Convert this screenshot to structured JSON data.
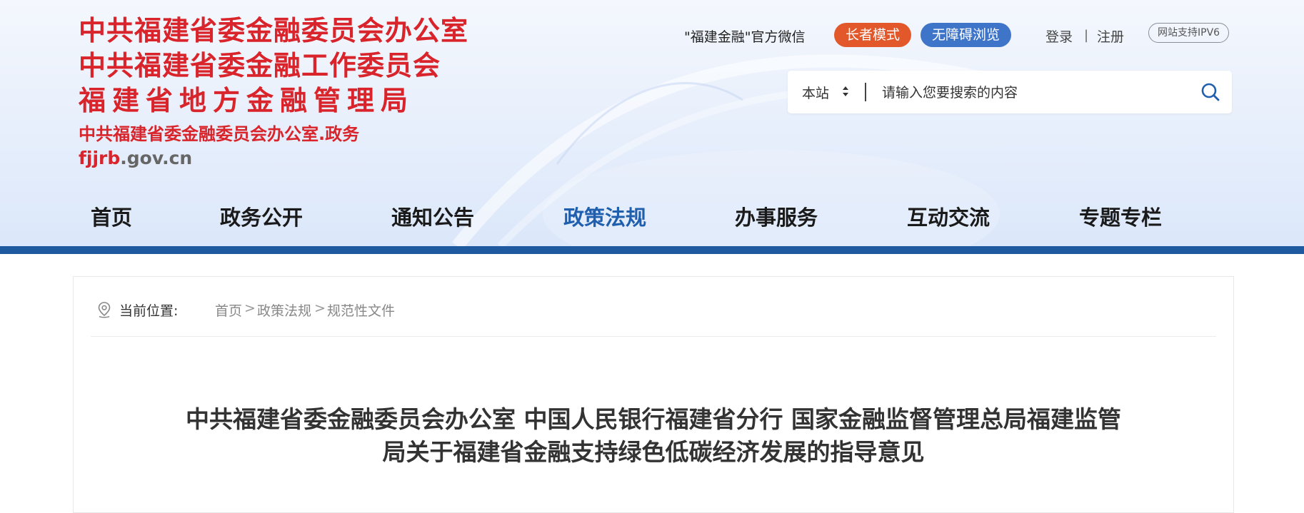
{
  "logo": {
    "lines": [
      "中共福建省委金融委员会办公室",
      "中共福建省委金融工作委员会",
      "福建省地方金融管理局"
    ],
    "subtitle": "中共福建省委金融委员会办公室.政务",
    "domain_red": "fjjrb",
    "domain_gray": ".gov.cn"
  },
  "top_links": {
    "wechat": "\"福建金融\"官方微信",
    "elder_mode": "长者模式",
    "accessible": "无障碍浏览",
    "login": "登录",
    "separator": "|",
    "register": "注册",
    "ipv6": "网站支持IPV6"
  },
  "search": {
    "scope": "本站",
    "placeholder": "请输入您要搜索的内容",
    "icon": "search-icon"
  },
  "nav": {
    "items": [
      "首页",
      "政务公开",
      "通知公告",
      "政策法规",
      "办事服务",
      "互动交流",
      "专题专栏"
    ],
    "active": "政策法规"
  },
  "breadcrumb": {
    "label": "当前位置:",
    "items": [
      "首页",
      "政策法规",
      "规范性文件"
    ],
    "arrow": ">"
  },
  "article": {
    "title_line1": "中共福建省委金融委员会办公室 中国人民银行福建省分行 国家金融监督管理总局福建监管",
    "title_line2": "局关于福建省金融支持绿色低碳经济发展的指导意见"
  },
  "colors": {
    "brand_red": "#d8242a",
    "nav_blue": "#1f5aa0",
    "active_blue": "#1f5fae",
    "elder_orange": "#e2582b",
    "access_blue": "#3f75c9"
  }
}
